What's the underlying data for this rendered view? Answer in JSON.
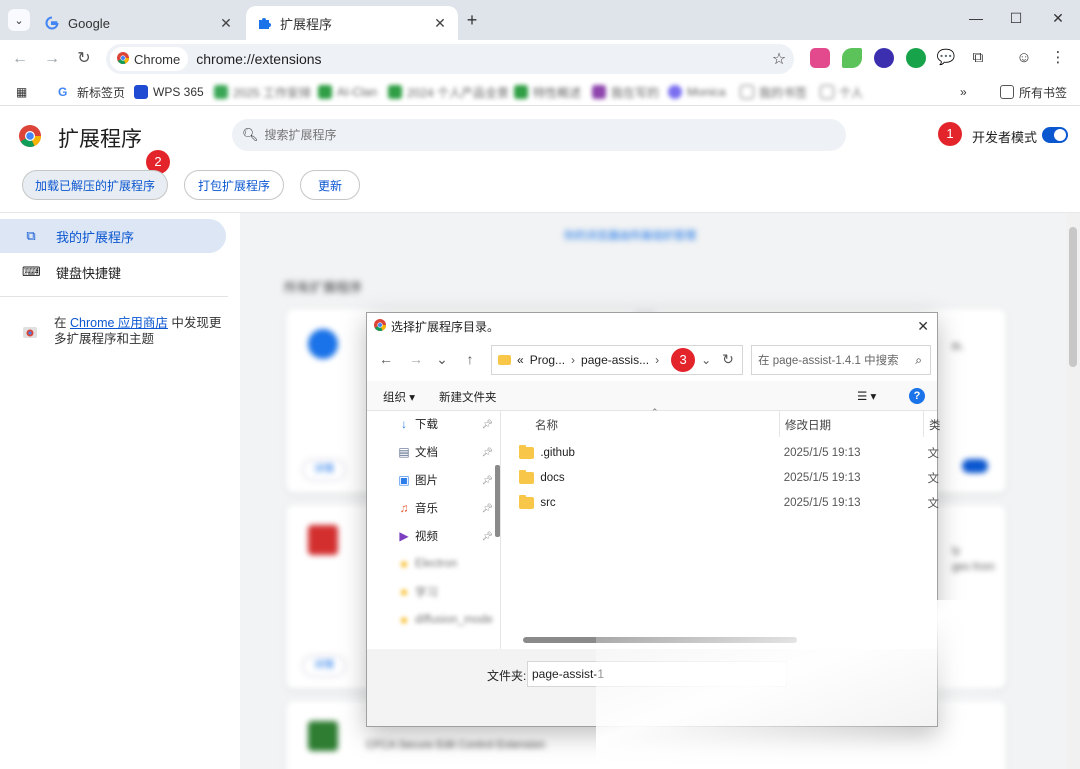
{
  "tabs": [
    {
      "title": "Google",
      "icon": "google-g-icon"
    },
    {
      "title": "扩展程序",
      "icon": "puzzle-icon"
    }
  ],
  "toolbar": {
    "chip_label": "Chrome",
    "url": "chrome://extensions"
  },
  "bookmarks": {
    "items": [
      "新标签页",
      "WPS 365",
      "2025 工作安排",
      "AI-Clan",
      "2024 个人产品全景",
      "特性概述",
      "我在写的",
      "Monica",
      "我的书签",
      "个人"
    ],
    "all_bookmarks": "所有书签"
  },
  "header": {
    "title": "扩展程序",
    "search_placeholder": "搜索扩展程序",
    "dev_mode_label": "开发者模式",
    "dev_mode_on": true,
    "load_unpacked": "加载已解压的扩展程序",
    "pack": "打包扩展程序",
    "update": "更新"
  },
  "badges": [
    "1",
    "2",
    "3"
  ],
  "sidebar": {
    "items": [
      {
        "label": "我的扩展程序",
        "icon": "puzzle-icon"
      },
      {
        "label": "键盘快捷键",
        "icon": "keyboard-icon"
      }
    ],
    "promo_prefix": "在 ",
    "promo_link": "Chrome 应用商店",
    "promo_suffix": " 中发现更多扩展程序和主题"
  },
  "background": {
    "notice": "你的浏览器由所属组织管理",
    "section_title": "所有扩展程序",
    "card_button": "详情",
    "last_card_name": "CFCA Secure Edit Control Extension",
    "card_text_a": "th.",
    "card_text_b": "ly",
    "card_text_c": "ges from"
  },
  "dialog": {
    "title": "选择扩展程序目录。",
    "path": [
      "Prog...",
      "page-assis..."
    ],
    "path_prefix": "«",
    "search_placeholder": "在 page-assist-1.4.1 中搜索",
    "organize": "组织",
    "new_folder": "新建文件夹",
    "columns": {
      "name": "名称",
      "date": "修改日期",
      "type": "类"
    },
    "tree": [
      {
        "label": "下载",
        "icon": "download-icon",
        "pinned": true
      },
      {
        "label": "文档",
        "icon": "document-icon",
        "pinned": true
      },
      {
        "label": "图片",
        "icon": "picture-icon",
        "pinned": true
      },
      {
        "label": "音乐",
        "icon": "music-icon",
        "pinned": true
      },
      {
        "label": "视频",
        "icon": "video-icon",
        "pinned": true
      },
      {
        "label": "Electron",
        "icon": "folder-icon",
        "pinned": false
      },
      {
        "label": "学习",
        "icon": "folder-icon",
        "pinned": false
      },
      {
        "label": "diffusion_mode",
        "icon": "folder-icon",
        "pinned": false
      }
    ],
    "files": [
      {
        "name": ".github",
        "date": "2025/1/5 19:13",
        "type": "文"
      },
      {
        "name": "docs",
        "date": "2025/1/5 19:13",
        "type": "文"
      },
      {
        "name": "src",
        "date": "2025/1/5 19:13",
        "type": "文"
      }
    ],
    "folder_label": "文件夹:",
    "folder_value": "page-assist-1"
  },
  "colors": {
    "accent": "#0b57d0",
    "badge": "#e3242b",
    "folder": "#f8c74a"
  }
}
